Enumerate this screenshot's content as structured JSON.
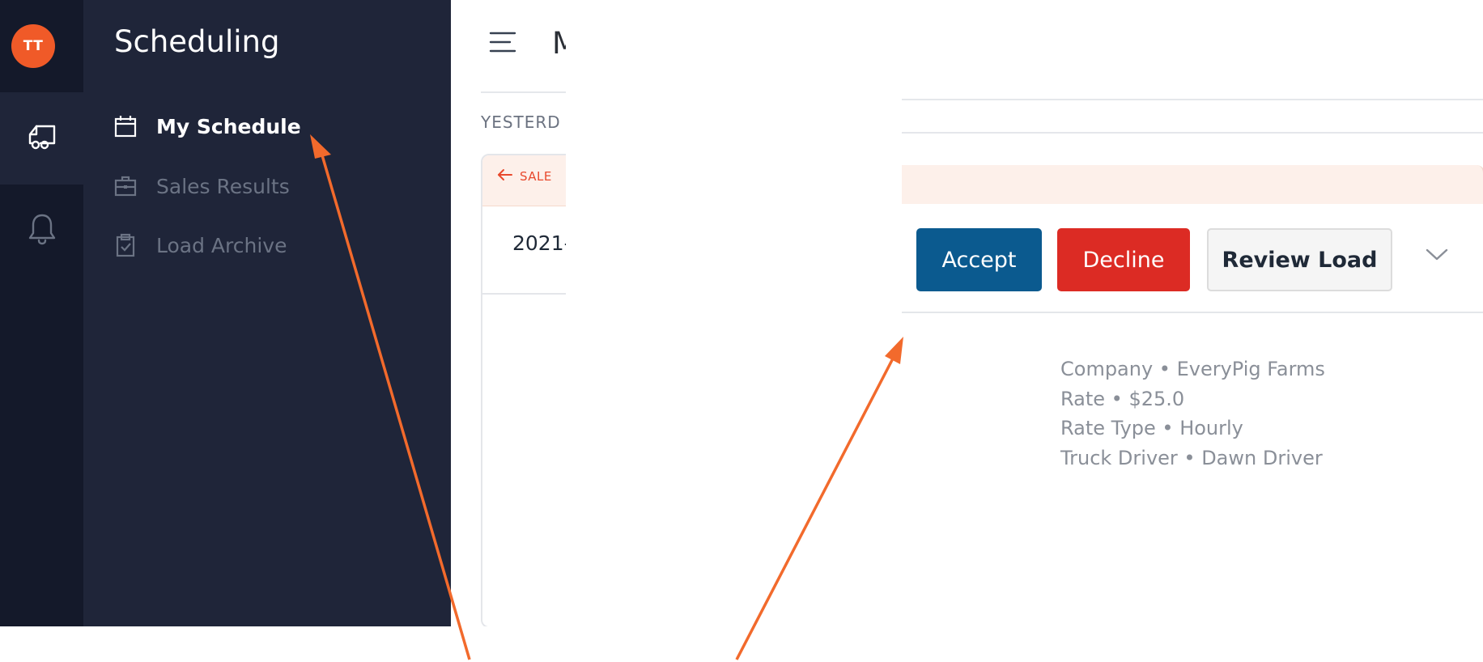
{
  "rail": {
    "avatar_initials": "TT",
    "items": [
      {
        "icon": "truck-icon",
        "active": true
      },
      {
        "icon": "bell-icon",
        "active": false
      }
    ]
  },
  "sidebar": {
    "title": "Scheduling",
    "items": [
      {
        "label": "My Schedule",
        "icon": "calendar-icon",
        "active": true
      },
      {
        "label": "Sales Results",
        "icon": "briefcase-icon",
        "active": false
      },
      {
        "label": "Load Archive",
        "icon": "clipboard-check-icon",
        "active": false
      }
    ]
  },
  "main": {
    "title_partial": "M",
    "day_label_partial": "YESTERD",
    "sale_label_partial": "SALE",
    "date_partial": "2021-",
    "actions": {
      "accept_label": "Accept",
      "decline_label": "Decline",
      "review_label": "Review Load"
    },
    "details": [
      "Company • EveryPig Farms",
      "Rate • $25.0",
      "Rate Type • Hourly",
      "Truck Driver • Dawn Driver"
    ]
  },
  "colors": {
    "rail_bg": "#14192a",
    "sidebar_bg": "#1f2539",
    "avatar": "#f05a28",
    "accept": "#0b5a8f",
    "decline": "#dc2b24",
    "sale_accent": "#e8492c",
    "annotation_arrow": "#f26a2c"
  }
}
